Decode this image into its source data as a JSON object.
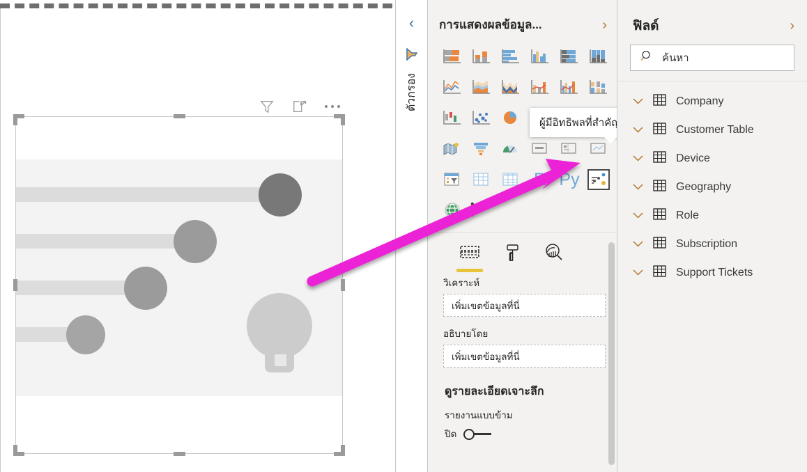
{
  "canvas": {
    "visual_header": {
      "filter_icon": "filter-icon",
      "focus_icon": "focus-mode-icon",
      "more_icon": "more-options-icon"
    },
    "placeholder_visual": {
      "name": "key-influencers-placeholder",
      "bars": [
        {
          "width_pct": 79,
          "bubble_r": 30,
          "bubble_color": "#787878"
        },
        {
          "width_pct": 56,
          "bubble_r": 30,
          "bubble_color": "#9b9b9b"
        },
        {
          "width_pct": 39,
          "bubble_r": 30,
          "bubble_color": "#9b9b9b"
        },
        {
          "width_pct": 21,
          "bubble_r": 27,
          "bubble_color": "#a5a5a5"
        }
      ],
      "bulb": "lightbulb-icon"
    }
  },
  "filter_rail": {
    "collapse_label": "ตัวกรอง",
    "chevron": "‹",
    "filter_icon": "funnel-icon"
  },
  "visualizations": {
    "title": "การแสดงผลข้อมูล...",
    "expand_chevron": "›",
    "tooltip": "ผู้มีอิทธิพลที่สำคัญ",
    "selected_icon_name": "key-influencers-icon",
    "icons": [
      "stacked-bar-chart-icon",
      "stacked-column-chart-icon",
      "clustered-bar-chart-icon",
      "clustered-column-chart-icon",
      "100-stacked-bar-chart-icon",
      "100-stacked-column-chart-icon",
      "line-chart-icon",
      "area-chart-icon",
      "stacked-area-chart-icon",
      "line-and-stacked-column-chart-icon",
      "line-and-clustered-column-chart-icon",
      "ribbon-chart-icon",
      "waterfall-chart-icon",
      "scatter-chart-icon",
      "pie-chart-icon",
      "donut-chart-icon",
      "treemap-icon",
      "map-icon",
      "filled-map-icon",
      "funnel-icon",
      "gauge-icon",
      "card-icon",
      "multi-row-card-icon",
      "kpi-icon",
      "slicer-icon",
      "table-icon",
      "matrix-icon",
      "r-script-visual-icon",
      "python-visual-icon",
      "key-influencers-icon",
      "arcgis-map-icon",
      "more-visuals-icon"
    ],
    "icon_labels": {
      "r": "R",
      "py": "Py",
      "ellipsis": "• • •"
    },
    "tabs": [
      {
        "name": "fields-tab",
        "icon": "fields-table-icon",
        "active": true
      },
      {
        "name": "format-tab",
        "icon": "paint-roller-icon",
        "active": false
      },
      {
        "name": "analytics-tab",
        "icon": "analytics-magnifier-icon",
        "active": false
      }
    ],
    "wells": [
      {
        "label": "วิเคราะห์",
        "placeholder": "เพิ่มเขตข้อมูลที่นี่"
      },
      {
        "label": "อธิบายโดย",
        "placeholder": "เพิ่มเขตข้อมูลที่นี่"
      }
    ],
    "drillthrough": {
      "title": "ดูรายละเอียดเจาะลึก",
      "cross_report_label": "รายงานแบบข้าม",
      "toggle_state": "ปิด"
    }
  },
  "fields": {
    "title": "ฟิลด์",
    "expand_chevron": "›",
    "search": {
      "placeholder": "ค้นหา",
      "icon": "search-icon"
    },
    "tables": [
      {
        "name": "Company"
      },
      {
        "name": "Customer Table"
      },
      {
        "name": "Device"
      },
      {
        "name": "Geography"
      },
      {
        "name": "Role"
      },
      {
        "name": "Subscription"
      },
      {
        "name": "Support Tickets"
      }
    ]
  },
  "annotation": {
    "arrow_color": "#ec20d6",
    "arrow_name": "magenta-callout-arrow"
  }
}
